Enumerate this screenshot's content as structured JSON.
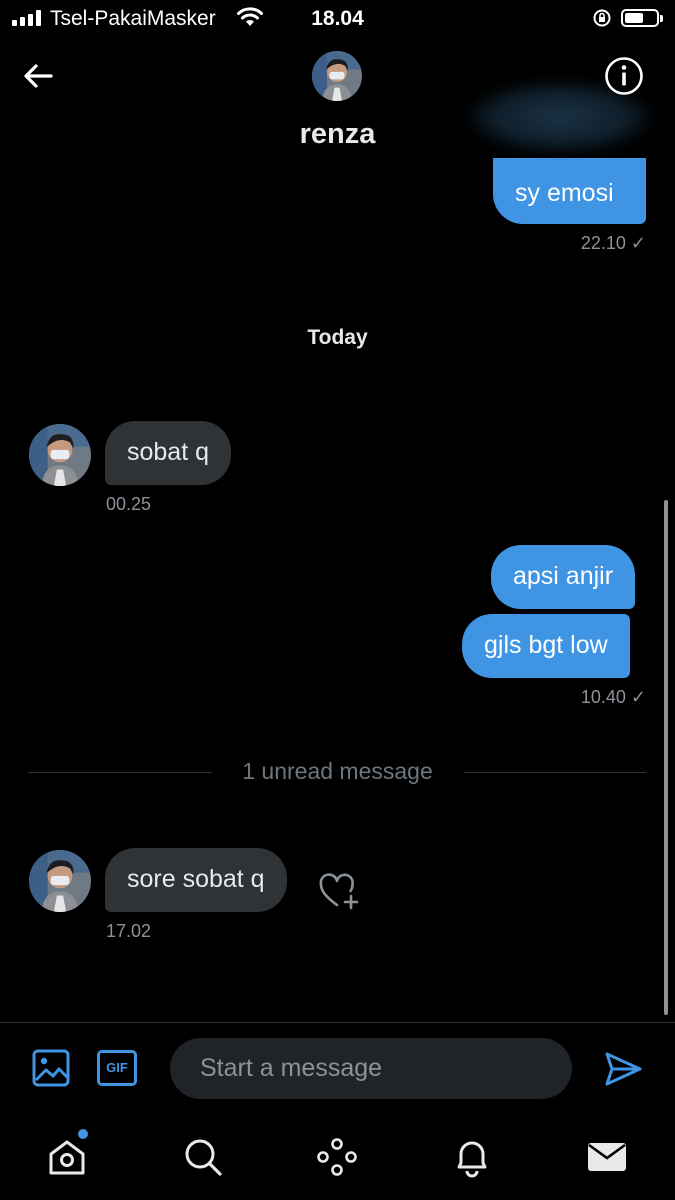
{
  "status_bar": {
    "carrier": "Tsel-PakaiMasker",
    "time": "18.04",
    "battery_level": 0.55
  },
  "header": {
    "contact_name": "renza",
    "back_icon": "arrow-left-icon",
    "info_icon": "info-circle-icon"
  },
  "messages": {
    "prev_outgoing": {
      "text": "sy emosi",
      "time": "22.10 ✓"
    },
    "day_label": "Today",
    "incoming_1": {
      "text": "sobat q",
      "time": "00.25"
    },
    "outgoing_1": {
      "text": "apsi anjir"
    },
    "outgoing_2": {
      "text": "gjls bgt low",
      "time": "10.40 ✓"
    },
    "unread_label": "1 unread message",
    "incoming_2": {
      "text": "sore sobat q",
      "time": "17.02"
    }
  },
  "composer": {
    "placeholder": "Start a message",
    "gif_label": "GIF",
    "image_icon": "image-icon",
    "send_icon": "send-icon"
  },
  "tabbar": {
    "items": [
      "home-icon",
      "search-icon",
      "spaces-icon",
      "bell-icon",
      "mail-icon"
    ]
  },
  "colors": {
    "accent": "#3f94e4",
    "incoming_bubble": "#2f3336",
    "background": "#000000"
  }
}
